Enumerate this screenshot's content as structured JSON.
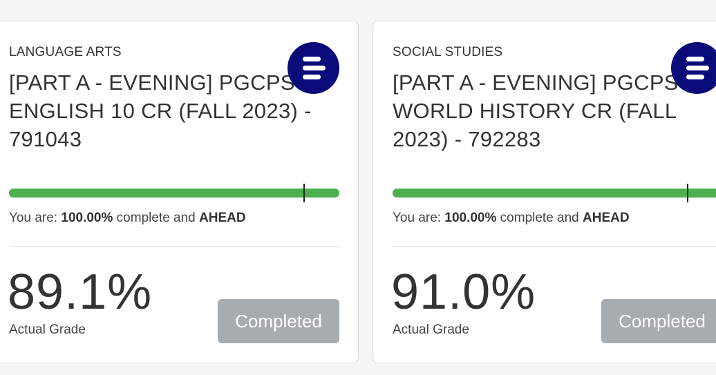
{
  "courses": [
    {
      "subject": "LANGUAGE ARTS",
      "title": "[PART A - EVENING] PGCPS ENGLISH 10 CR (FALL 2023) - 791043",
      "status_prefix": "You are: ",
      "percent_complete": "100.00%",
      "status_middle": " complete and ",
      "pace": "AHEAD",
      "progress_fraction": 1.0,
      "grade": "89.1%",
      "grade_label": "Actual Grade",
      "button_label": "Completed",
      "icon": "edgenuity-logo-icon"
    },
    {
      "subject": "SOCIAL STUDIES",
      "title": "[PART A - EVENING] PGCPS WORLD HISTORY CR (FALL 2023) - 792283",
      "status_prefix": "You are: ",
      "percent_complete": "100.00%",
      "status_middle": " complete and ",
      "pace": "AHEAD",
      "progress_fraction": 1.0,
      "grade": "91.0%",
      "grade_label": "Actual Grade",
      "button_label": "Completed",
      "icon": "edgenuity-logo-icon"
    }
  ],
  "colors": {
    "progress_fill": "#4caf50",
    "logo_bg": "#0a0a78",
    "button_bg": "#a7acb1"
  }
}
